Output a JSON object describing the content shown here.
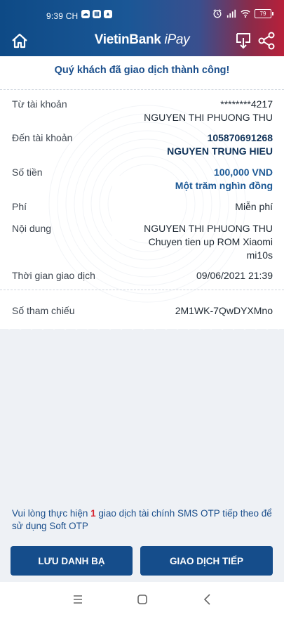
{
  "status_bar": {
    "time": "9:39 CH",
    "battery": "79"
  },
  "header": {
    "brand_main": "VietinBank",
    "brand_sub": "iPay"
  },
  "receipt": {
    "success_message": "Quý khách đã giao dịch thành công!",
    "rows": {
      "from": {
        "label": "Từ tài khoản",
        "account": "********4217",
        "name": "NGUYEN THI PHUONG THU"
      },
      "to": {
        "label": "Đến tài khoản",
        "account": "105870691268",
        "name": "NGUYEN TRUNG HIEU"
      },
      "amount": {
        "label": "Số tiền",
        "value": "100,000 VND",
        "words": "Một trăm nghìn đồng"
      },
      "fee": {
        "label": "Phí",
        "value": "Miễn phí"
      },
      "content": {
        "label": "Nội dung",
        "line1": "NGUYEN THI PHUONG THU",
        "line2": "Chuyen tien up ROM Xiaomi",
        "line3": "mi10s"
      },
      "time": {
        "label": "Thời gian giao dịch",
        "value": "09/06/2021 21:39"
      },
      "reference": {
        "label": "Số tham chiếu",
        "value": "2M1WK-7QwDYXMno"
      }
    }
  },
  "otp_notice": {
    "before": "Vui lòng thực hiện ",
    "count": "1",
    "after": " giao dịch tài chính SMS OTP tiếp theo để sử dụng Soft OTP"
  },
  "buttons": {
    "save_contact": "LƯU DANH BẠ",
    "next_transaction": "GIAO DỊCH TIẾP"
  },
  "colors": {
    "primary": "#154d8b",
    "text_blue": "#1e5a96",
    "highlight_red": "#d6232f"
  }
}
